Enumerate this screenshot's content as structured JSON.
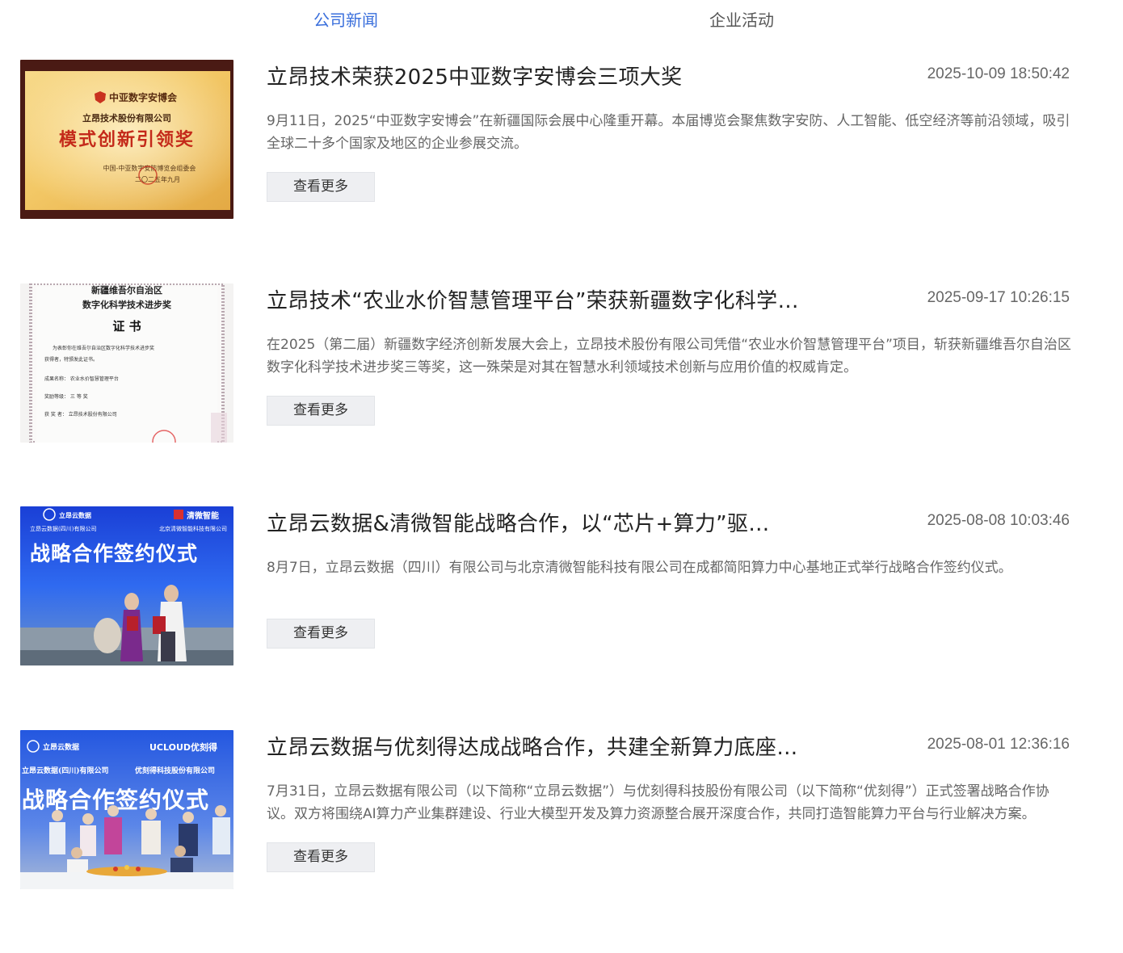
{
  "tabs": [
    {
      "label": "公司新闻",
      "active": true
    },
    {
      "label": "企业活动",
      "active": false
    }
  ],
  "colors": {
    "accent": "#3a6fdc",
    "button_bg": "#eeeff2",
    "title": "#222222",
    "meta": "#666666"
  },
  "articles": [
    {
      "title": "立昂技术荣获2025中亚数字安博会三项大奖",
      "date": "2025-10-09 18:50:42",
      "summary": "9月11日，2025“中亚数字安博会”在新疆国际会展中心隆重开幕。本届博览会聚焦数字安防、人工智能、低空经济等前沿领域，吸引全球二十多个国家及地区的企业参展交流。",
      "button": "查看更多",
      "image": {
        "kind": "gold-award-plaque",
        "header": "中亚数字安博会",
        "company": "立昂技术股份有限公司",
        "award": "模式创新引领奖",
        "footer1": "中国-中亚数字安防博览会组委会",
        "footer2": "二〇二五年九月"
      }
    },
    {
      "title": "立昂技术“农业水价智慧管理平台”荣获新疆数字化科学技术进步奖三等奖",
      "date": "2025-09-17 10:26:15",
      "summary": "在2025（第二届）新疆数字经济创新发展大会上，立昂技术股份有限公司凭借“农业水价智慧管理平台”项目，斩获新疆维吾尔自治区数字化科学技术进步奖三等奖，这一殊荣是对其在智慧水利领域技术创新与应用价值的权威肯定。",
      "button": "查看更多",
      "image": {
        "kind": "certificate",
        "line1": "新疆维吾尔自治区",
        "line2": "数字化科学技术进步奖",
        "line3": "证  书",
        "body1": "为表彰你在维吾尔自治区数字化科学技术进步奖",
        "body2": "获得者，特颁发此证书。",
        "field1": "成果名称：  农业水价智慧管理平台",
        "field2": "奖励等级：  三 等 奖",
        "field3": "获 奖 者：  立昂技术股份有限公司"
      }
    },
    {
      "title": "立昂云数据&清微智能战略合作，以“芯片+算力”驱动产业发展",
      "date": "2025-08-08 10:03:46",
      "summary": "8月7日，立昂云数据（四川）有限公司与北京清微智能科技有限公司在成都简阳算力中心基地正式举行战略合作签约仪式。",
      "button": "查看更多",
      "image": {
        "kind": "signing-photo",
        "logo_left": "立昂云数据",
        "logo_right": "清微智能",
        "sub_left": "立昂云数据(四川)有限公司",
        "sub_right": "北京清微智能科技有限公司",
        "banner": "战略合作签约仪式"
      }
    },
    {
      "title": "立昂云数据与优刻得达成战略合作，共建全新算力底座生态",
      "date": "2025-08-01 12:36:16",
      "summary": "7月31日，立昂云数据有限公司（以下简称“立昂云数据”）与优刻得科技股份有限公司（以下简称“优刻得”）正式签署战略合作协议。双方将围绕AI算力产业集群建设、行业大模型开发及算力资源整合展开深度合作，共同打造智能算力平台与行业解决方案。",
      "button": "查看更多",
      "image": {
        "kind": "group-photo",
        "logo_left": "立昂云数据",
        "logo_right": "UCLOUD优刻得",
        "sub_left": "立昂云数据(四川)有限公司",
        "sub_right": "优刻得科技股份有限公司",
        "banner": "战略合作签约仪式"
      }
    }
  ]
}
